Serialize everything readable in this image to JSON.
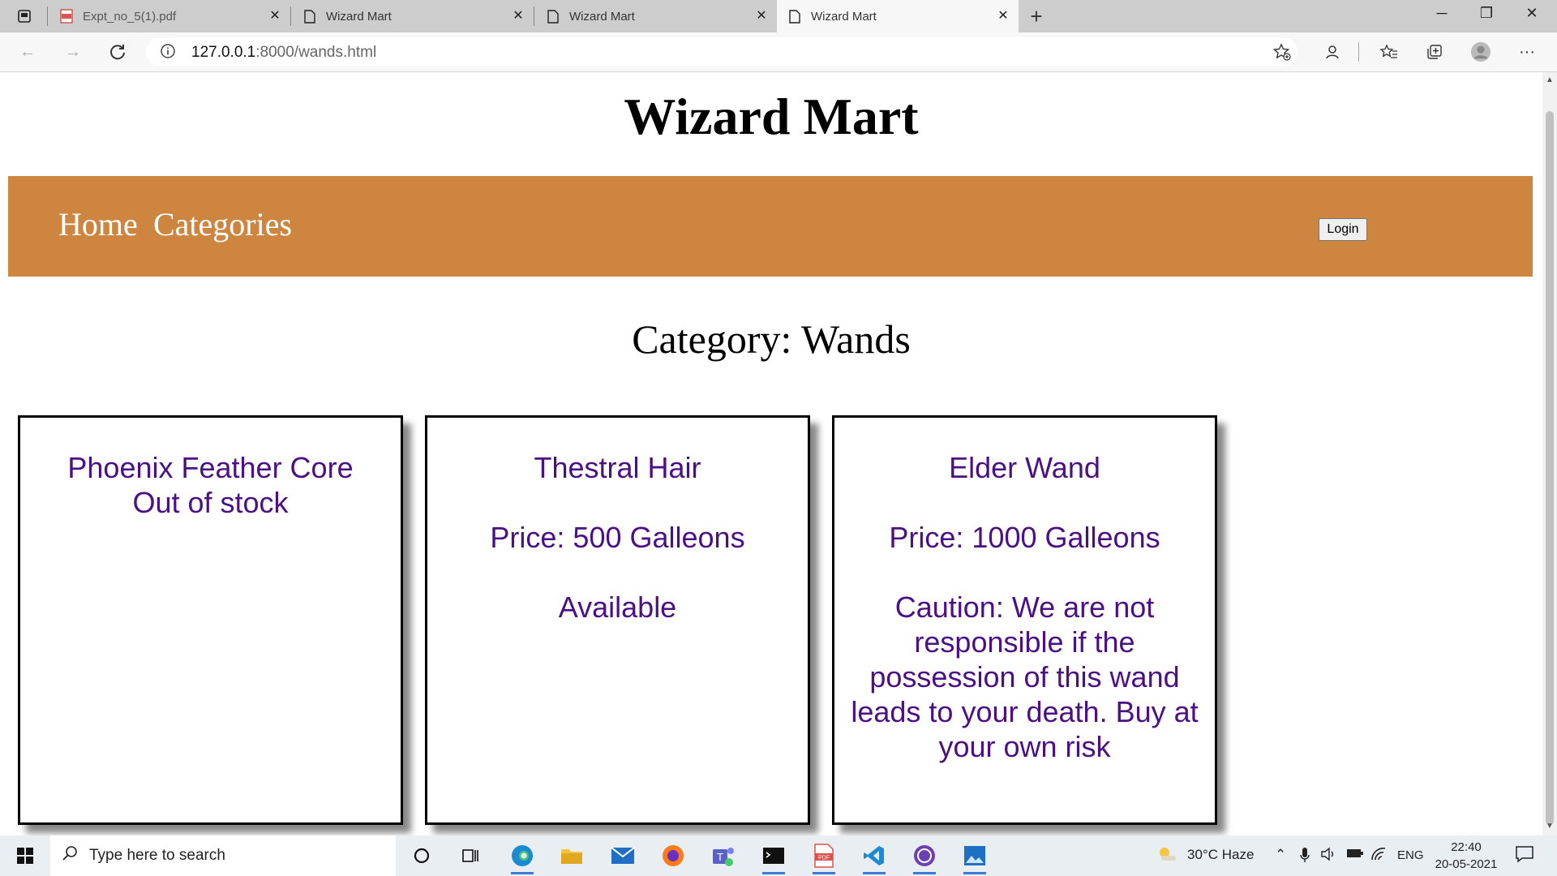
{
  "browser": {
    "tabs": [
      {
        "title": "Expt_no_5(1).pdf",
        "icon": "pdf-icon",
        "active": false
      },
      {
        "title": "Wizard Mart",
        "icon": "page-icon",
        "active": false
      },
      {
        "title": "Wizard Mart",
        "icon": "page-icon",
        "active": false
      },
      {
        "title": "Wizard Mart",
        "icon": "page-icon",
        "active": true
      }
    ],
    "url_host": "127.0.0.1",
    "url_rest": ":8000/wands.html"
  },
  "site": {
    "title": "Wizard Mart",
    "nav": {
      "home": "Home",
      "categories": "Categories",
      "login": "Login"
    },
    "category_heading": "Category: Wands",
    "accent_color": "#cd853f",
    "text_color": "#4b0f86",
    "products": [
      {
        "name": "Phoenix Feather Core",
        "line1": "Out of stock",
        "line2": ""
      },
      {
        "name": "Thestral Hair",
        "line1": "Price: 500 Galleons",
        "line2": "Available"
      },
      {
        "name": "Elder Wand",
        "line1": "Price: 1000 Galleons",
        "line2": "Caution: We are not responsible if the possession of this wand leads to your death. Buy at your own risk"
      }
    ]
  },
  "taskbar": {
    "search_placeholder": "Type here to search",
    "weather": "30°C  Haze",
    "lang": "ENG",
    "time": "22:40",
    "date": "20-05-2021"
  }
}
